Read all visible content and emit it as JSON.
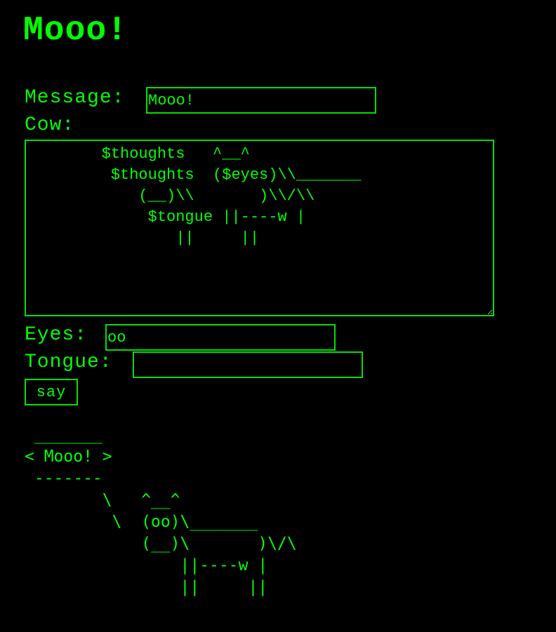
{
  "page": {
    "title": "Mooo!"
  },
  "form": {
    "message_label": "Message:",
    "message_value": "Mooo!",
    "cow_label": "Cow:",
    "cow_value": "        $thoughts   ^__^\n         $thoughts  ($eyes)\\\\_______\n            (__)\\\\       )\\\\/\\\\\n             $tongue ||----w |\n                ||     ||",
    "eyes_label": "Eyes:",
    "eyes_value": "oo",
    "tongue_label": "Tongue:",
    "tongue_value": "",
    "say_label": "say"
  },
  "output": {
    "cowsay_text": " _______\n< Mooo! >\n -------\n        \\   ^__^\n         \\  (oo)\\_______\n            (__)\\       )\\/\\\n                ||----w |\n                ||     ||"
  },
  "colors": {
    "text": "#00ff00",
    "background": "#000000",
    "border": "#00e000"
  }
}
